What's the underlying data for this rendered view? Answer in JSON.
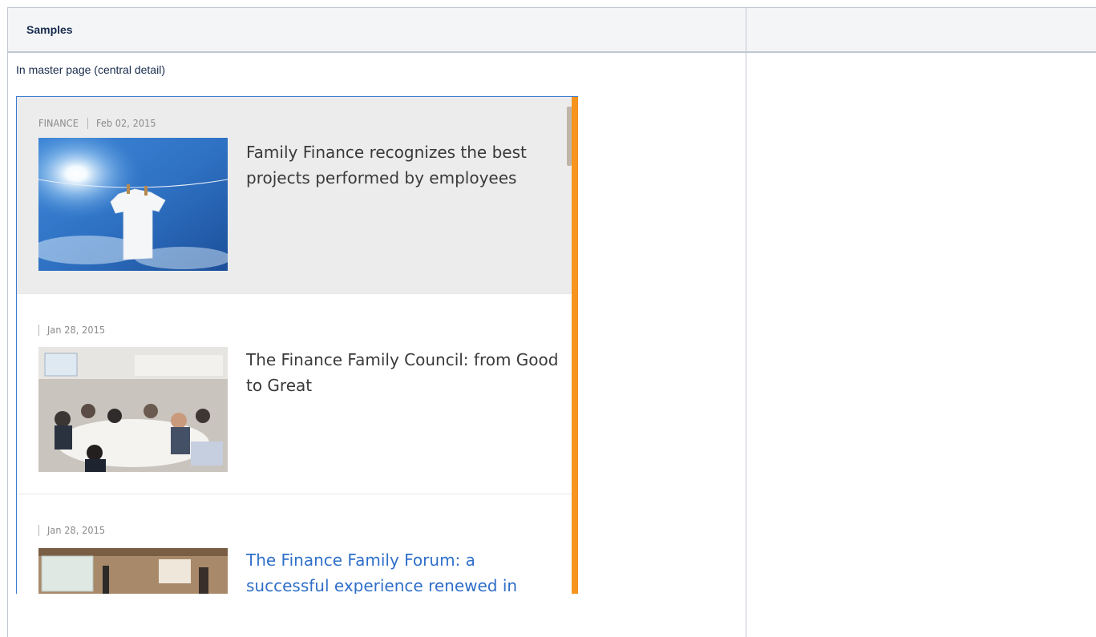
{
  "table": {
    "header_title": "Samples",
    "header_second": ""
  },
  "caption": "In master page (central detail)",
  "news": {
    "items": [
      {
        "category": "FINANCE",
        "date": "Feb 02, 2015",
        "title": "Family Finance recognizes the best projects performed by employees",
        "image": "clothesline-shirt-sky-photo",
        "active": true
      },
      {
        "category": "",
        "date": "Jan 28, 2015",
        "title": "The Finance Family Council: from Good to Great",
        "image": "conference-room-photo",
        "active": false
      },
      {
        "category": "",
        "date": "Jan 28, 2015",
        "title": "The Finance Family Forum: a successful experience renewed in",
        "image": "presentation-room-photo",
        "active": false
      }
    ]
  },
  "colors": {
    "accent_bar": "#f7941d",
    "link": "#2f6fc9",
    "header_bg": "#f4f5f7"
  }
}
